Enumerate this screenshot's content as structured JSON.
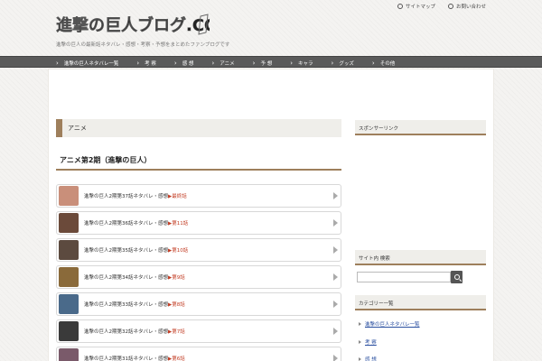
{
  "header": {
    "logo_text": "進撃の巨人ブログ.COM",
    "tagline": "進撃の巨人の最新話ネタバレ・感想・考察・予想をまとめたファンブログです",
    "toplinks": [
      {
        "label": "サイトマップ"
      },
      {
        "label": "お問い合わせ"
      }
    ]
  },
  "nav": {
    "items": [
      {
        "label": "進撃の巨人ネタバレ一覧"
      },
      {
        "label": "考 察"
      },
      {
        "label": "感 想"
      },
      {
        "label": "アニメ"
      },
      {
        "label": "予 想"
      },
      {
        "label": "キャラ"
      },
      {
        "label": "グッズ"
      },
      {
        "label": "その他"
      }
    ]
  },
  "main": {
    "category": "アニメ",
    "section_title": "アニメ第2期（進撃の巨人）",
    "posts": [
      {
        "title": "進撃の巨人2期第37話ネタバレ・感想",
        "ep": "▶最終話",
        "thumb_color": "#c98f7a"
      },
      {
        "title": "進撃の巨人2期第36話ネタバレ・感想",
        "ep": "▶第11話",
        "thumb_color": "#6b4a3a"
      },
      {
        "title": "進撃の巨人2期第35話ネタバレ・感想",
        "ep": "▶第10話",
        "thumb_color": "#5c4a3f"
      },
      {
        "title": "進撃の巨人2期第34話ネタバレ・感想",
        "ep": "▶第9話",
        "thumb_color": "#8a6a3a"
      },
      {
        "title": "進撃の巨人2期第33話ネタバレ・感想",
        "ep": "▶第8話",
        "thumb_color": "#4a6a8a"
      },
      {
        "title": "進撃の巨人2期第32話ネタバレ・感想",
        "ep": "▶第7話",
        "thumb_color": "#3a3a3a"
      },
      {
        "title": "進撃の巨人2期第31話ネタバレ・感想",
        "ep": "▶第6話",
        "thumb_color": "#7a5a6a"
      }
    ]
  },
  "sidebar": {
    "widget1_title": "スポンサーリンク",
    "search_title": "サイト内 検索",
    "search_placeholder": "",
    "categories_title": "カテゴリー一覧",
    "links": [
      {
        "label": "進撃の巨人ネタバレ一覧"
      },
      {
        "label": "考 察"
      },
      {
        "label": "感 想"
      }
    ]
  }
}
